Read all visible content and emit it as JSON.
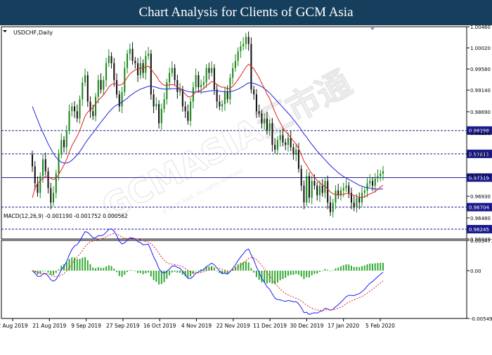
{
  "header": {
    "title": "Chart Analysis for Clients of GCM Asia"
  },
  "watermark": {
    "text": "GCMASIA汇市通",
    "subtext": "© GCM ASIA. All rights reserved."
  },
  "colors": {
    "banner": "#163f5e",
    "bull": "#1a8a1a",
    "bear": "#111111",
    "sma_fast": "#e02020",
    "sma_slow": "#2222dd",
    "macd_hist": "#33aa33",
    "macd_line": "#1a1aff",
    "macd_signal": "#e02020",
    "level_line": "#1a1a8c",
    "level_label_bg": "#1a1a8c"
  },
  "chart_data": [
    {
      "type": "candlestick",
      "title": "USDCHF,Daily",
      "ylim": [
        0.9604,
        1.0046
      ],
      "y_ticks": [
        "1.00460",
        "1.00020",
        "0.99580",
        "0.99140",
        "0.98690",
        "0.98250",
        "0.97810",
        "0.97370",
        "0.96930",
        "0.96480",
        "0.96040"
      ],
      "x_ticks": [
        "2 Aug 2019",
        "21 Aug 2019",
        "9 Sep 2019",
        "27 Sep 2019",
        "16 Oct 2019",
        "4 Nov 2019",
        "22 Nov 2019",
        "11 Dec 2019",
        "30 Dec 2019",
        "17 Jan 2020",
        "5 Feb 2020"
      ],
      "levels": [
        {
          "value": 0.98298,
          "label": "0.98298",
          "style": "dashed"
        },
        {
          "value": 0.97813,
          "label": "0.97813",
          "style": "dashed"
        },
        {
          "value": 0.97319,
          "label": "0.97319",
          "style": "solid"
        },
        {
          "value": 0.96704,
          "label": "0.96704",
          "style": "dashed"
        },
        {
          "value": 0.96245,
          "label": "0.96245",
          "style": "dashed"
        }
      ],
      "close": [
        0.9755,
        0.972,
        0.97,
        0.9735,
        0.977,
        0.9745,
        0.971,
        0.968,
        0.97,
        0.974,
        0.978,
        0.981,
        0.9795,
        0.983,
        0.987,
        0.988,
        0.987,
        0.9855,
        0.9895,
        0.993,
        0.9945,
        0.989,
        0.987,
        0.986,
        0.99,
        0.9935,
        0.9915,
        0.9935,
        0.997,
        0.9985,
        0.997,
        0.9935,
        0.9905,
        0.988,
        0.991,
        0.996,
        0.999,
        1.0,
        0.9975,
        0.997,
        0.9945,
        0.997,
        0.995,
        0.9985,
        0.999,
        0.9905,
        0.988,
        0.9885,
        0.9845,
        0.9875,
        0.9895,
        0.993,
        0.995,
        0.996,
        0.9935,
        0.991,
        0.9915,
        0.988,
        0.987,
        0.985,
        0.989,
        0.992,
        0.9945,
        0.992,
        0.9925,
        0.993,
        0.996,
        0.995,
        0.996,
        0.9915,
        0.989,
        0.988,
        0.9885,
        0.991,
        0.9895,
        0.994,
        0.996,
        0.9975,
        0.9995,
        1.0005,
        1.001,
        1.0025,
        1.001,
        0.9915,
        0.9905,
        0.987,
        0.9865,
        0.9845,
        0.9855,
        0.983,
        0.9845,
        0.98,
        0.979,
        0.981,
        0.982,
        0.9805,
        0.98,
        0.9815,
        0.9795,
        0.978,
        0.979,
        0.975,
        0.9715,
        0.968,
        0.9735,
        0.969,
        0.9725,
        0.9715,
        0.9695,
        0.9715,
        0.97,
        0.9725,
        0.968,
        0.966,
        0.968,
        0.9705,
        0.9695,
        0.9705,
        0.971,
        0.9715,
        0.97,
        0.968,
        0.967,
        0.969,
        0.968,
        0.97,
        0.9705,
        0.972,
        0.9725,
        0.9715,
        0.973,
        0.9735,
        0.974,
        0.9745
      ],
      "sma_fast": [
        0.969,
        0.971,
        0.972,
        0.9725,
        0.973,
        0.9735,
        0.9735,
        0.973,
        0.9728,
        0.973,
        0.9738,
        0.9748,
        0.9758,
        0.977,
        0.9785,
        0.9798,
        0.9808,
        0.9818,
        0.983,
        0.9845,
        0.986,
        0.9868,
        0.9873,
        0.9878,
        0.9885,
        0.9893,
        0.9898,
        0.9904,
        0.9912,
        0.992,
        0.9926,
        0.9928,
        0.9926,
        0.9924,
        0.9926,
        0.9932,
        0.994,
        0.9948,
        0.9952,
        0.9956,
        0.9958,
        0.996,
        0.996,
        0.9962,
        0.9964,
        0.9958,
        0.995,
        0.9944,
        0.9934,
        0.9928,
        0.9924,
        0.9924,
        0.9925,
        0.9926,
        0.9924,
        0.992,
        0.9918,
        0.9912,
        0.9906,
        0.99,
        0.99,
        0.9904,
        0.991,
        0.9912,
        0.9914,
        0.9917,
        0.9923,
        0.9927,
        0.9932,
        0.993,
        0.9926,
        0.9922,
        0.992,
        0.992,
        0.9916,
        0.9918,
        0.9922,
        0.9928,
        0.9936,
        0.9944,
        0.9953,
        0.9962,
        0.9968,
        0.9964,
        0.9958,
        0.9949,
        0.994,
        0.9928,
        0.9918,
        0.9906,
        0.9896,
        0.9882,
        0.9868,
        0.9856,
        0.9846,
        0.9836,
        0.9828,
        0.9822,
        0.9815,
        0.9808,
        0.9802,
        0.9792,
        0.978,
        0.9766,
        0.9758,
        0.9748,
        0.974,
        0.9733,
        0.9726,
        0.9721,
        0.9716,
        0.9714,
        0.9708,
        0.9702,
        0.9698,
        0.9697,
        0.9696,
        0.9696,
        0.9697,
        0.9699,
        0.9699,
        0.9697,
        0.9695,
        0.9693,
        0.9691,
        0.9691,
        0.9692,
        0.9695,
        0.9698,
        0.97,
        0.9703,
        0.9707,
        0.9712,
        0.9716
      ],
      "sma_slow": [
        0.988,
        0.9866,
        0.9852,
        0.9838,
        0.9826,
        0.9814,
        0.9802,
        0.9792,
        0.9782,
        0.9774,
        0.9768,
        0.9764,
        0.9762,
        0.9762,
        0.9764,
        0.9768,
        0.9773,
        0.9779,
        0.9786,
        0.9794,
        0.9803,
        0.9811,
        0.9818,
        0.9825,
        0.9832,
        0.984,
        0.9847,
        0.9854,
        0.9861,
        0.9868,
        0.9874,
        0.9879,
        0.9883,
        0.9886,
        0.9889,
        0.9893,
        0.9897,
        0.9902,
        0.9906,
        0.991,
        0.9913,
        0.9916,
        0.9918,
        0.992,
        0.9922,
        0.9922,
        0.9921,
        0.992,
        0.9918,
        0.9917,
        0.9916,
        0.9916,
        0.9916,
        0.9917,
        0.9917,
        0.9917,
        0.9916,
        0.9915,
        0.9913,
        0.9911,
        0.991,
        0.991,
        0.991,
        0.991,
        0.991,
        0.991,
        0.9911,
        0.9912,
        0.9913,
        0.9913,
        0.9913,
        0.9912,
        0.9911,
        0.9911,
        0.991,
        0.9911,
        0.9912,
        0.9914,
        0.9916,
        0.9919,
        0.9922,
        0.9926,
        0.9929,
        0.9929,
        0.9928,
        0.9926,
        0.9924,
        0.9921,
        0.9917,
        0.9913,
        0.9908,
        0.9902,
        0.9896,
        0.989,
        0.9884,
        0.9878,
        0.9872,
        0.9866,
        0.986,
        0.9853,
        0.9846,
        0.9839,
        0.9831,
        0.9823,
        0.9816,
        0.9808,
        0.9801,
        0.9794,
        0.9787,
        0.9781,
        0.9775,
        0.9769,
        0.9763,
        0.9757,
        0.9752,
        0.9747,
        0.9742,
        0.9738,
        0.9734,
        0.9731,
        0.9728,
        0.9725,
        0.9722,
        0.9719,
        0.9716,
        0.9714,
        0.9712,
        0.9711,
        0.971,
        0.9709,
        0.9708,
        0.9708,
        0.9708,
        0.9708
      ]
    },
    {
      "type": "macd",
      "title": "MACD(12,26,9) -0.001190 -0.001752 0.000562",
      "ylim": [
        -0.005496,
        0.003477
      ],
      "y_ticks": [
        "0.003477",
        "0.00",
        "-0.005496"
      ]
    }
  ]
}
